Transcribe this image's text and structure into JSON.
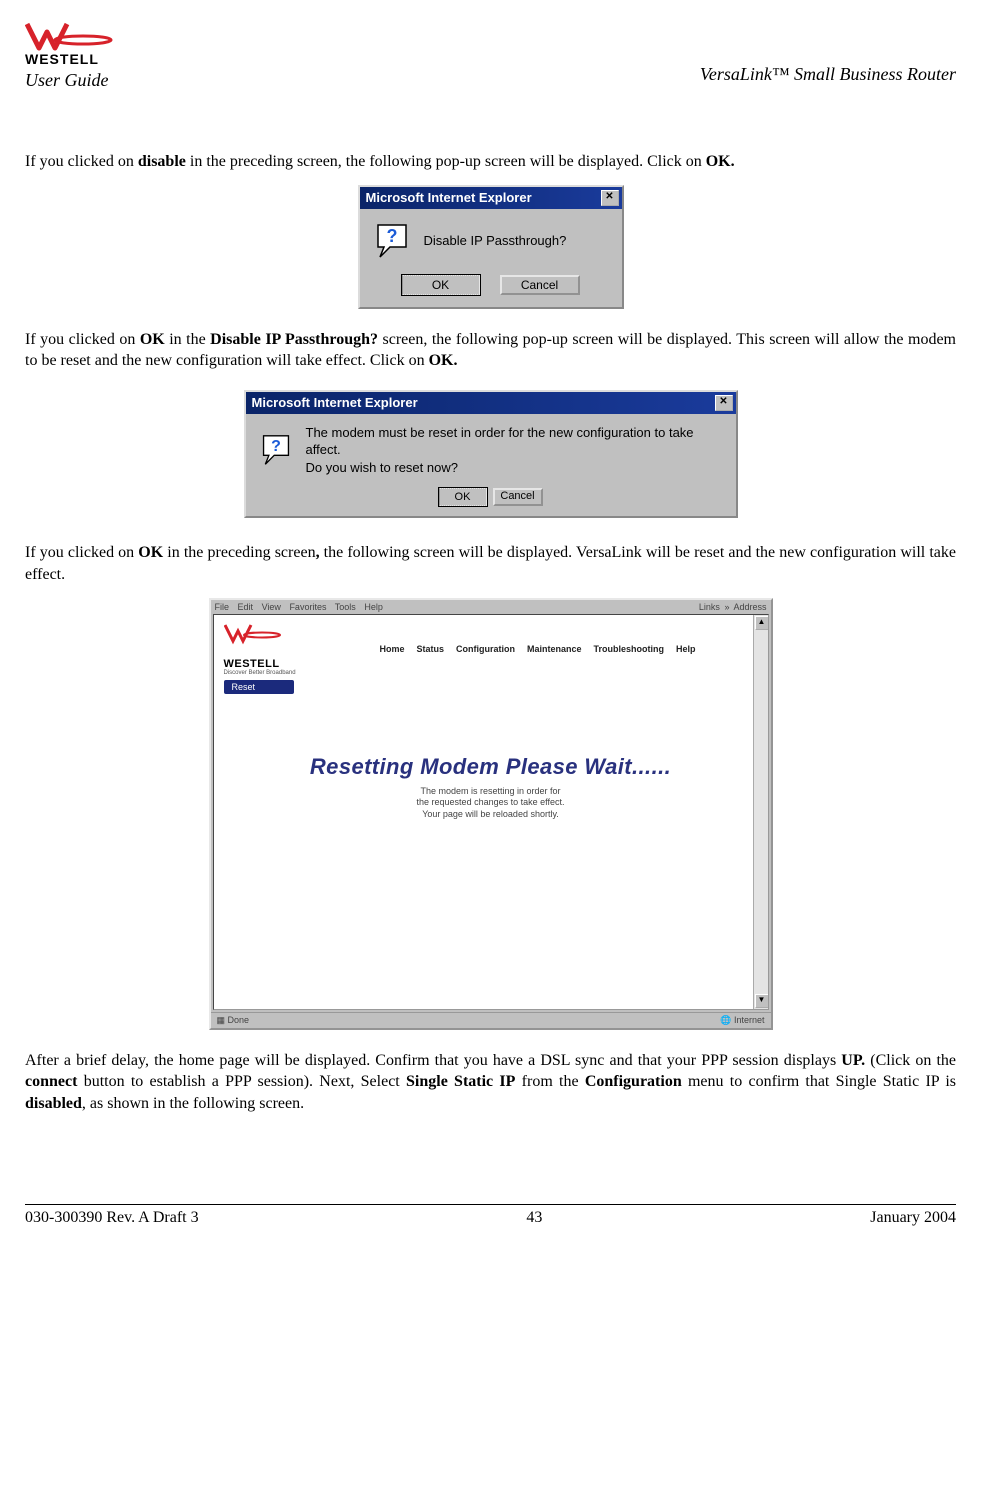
{
  "header": {
    "logo_text": "WESTELL",
    "user_guide": "User Guide",
    "product_title": "VersaLink™  Small Business Router"
  },
  "para1": {
    "t1": "If you clicked on ",
    "b1": "disable",
    "t2": " in the preceding screen, the following pop-up screen will be displayed. Click on ",
    "b2": "OK.",
    "t3": ""
  },
  "dialog1": {
    "title": "Microsoft Internet Explorer",
    "close": "✕",
    "message": "Disable IP Passthrough?",
    "ok": "OK",
    "cancel": "Cancel"
  },
  "para2": {
    "t1": "If you clicked on ",
    "b1": "OK",
    "t2": " in the ",
    "b2": "Disable IP Passthrough?",
    "t3": " screen, the following pop-up screen will be displayed. This screen will allow the modem to be reset and the new configuration will take effect. Click on ",
    "b3": "OK.",
    "t4": ""
  },
  "dialog2": {
    "title": "Microsoft Internet Explorer",
    "close": "✕",
    "line1": "The modem must be reset in order for the new configuration to take affect.",
    "line2": "Do you wish to reset now?",
    "ok": "OK",
    "cancel": "Cancel"
  },
  "para3": {
    "t1": "If you clicked on ",
    "b1": "OK",
    "t2": " in the preceding screen",
    "b2": ",",
    "t3": " the following screen will be displayed. VersaLink will be reset and the new configuration will take effect."
  },
  "browser": {
    "menu": {
      "file": "File",
      "edit": "Edit",
      "view": "View",
      "favorites": "Favorites",
      "tools": "Tools",
      "help": "Help",
      "links": "Links",
      "address": "Address"
    },
    "logo_text": "WESTELL",
    "logo_sub": "Discover  Better  Broadband",
    "nav": [
      "Home",
      "Status",
      "Configuration",
      "Maintenance",
      "Troubleshooting",
      "Help"
    ],
    "sub_button": "Reset",
    "reset_title": "Resetting Modem Please Wait......",
    "reset_msg1": "The modem is resetting in order for",
    "reset_msg2": "the requested changes to take effect.",
    "reset_msg3": "Your page will be reloaded shortly.",
    "status_left": "Done",
    "status_right": "Internet"
  },
  "para4": {
    "t1": "After a brief delay, the home page will be displayed. Confirm that you have a DSL sync and that your PPP session displays ",
    "b1": "UP.",
    "t2": " (Click on the ",
    "b2": "connect",
    "t3": " button to establish a PPP session). Next, Select ",
    "b3": "Single Static IP",
    "t4": " from the ",
    "b4": "Configuration",
    "t5": " menu to confirm that Single Static IP is ",
    "b5": "disabled",
    "t6": ", as shown in the following screen."
  },
  "footer": {
    "left": "030-300390 Rev. A Draft 3",
    "center": "43",
    "right": "January 2004"
  }
}
